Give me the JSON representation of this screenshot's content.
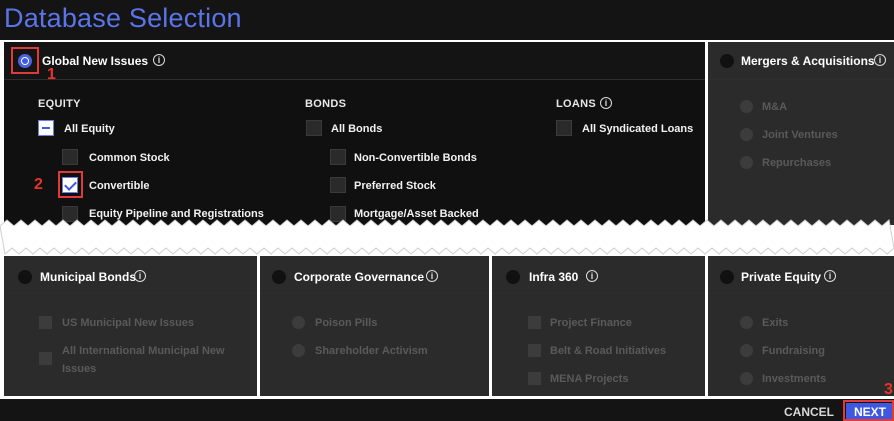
{
  "window": {
    "title": "Database Selection"
  },
  "global_new_issues": {
    "label": "Global New Issues",
    "info": "i",
    "columns": {
      "equity": {
        "heading": "EQUITY",
        "items": [
          "All Equity",
          "Common Stock",
          "Convertible",
          "Equity Pipeline and Registrations"
        ]
      },
      "bonds": {
        "heading": "BONDS",
        "items": [
          "All Bonds",
          "Non-Convertible Bonds",
          "Preferred Stock",
          "Mortgage/Asset Backed"
        ]
      },
      "loans": {
        "heading": "LOANS",
        "items": [
          "All Syndicated Loans"
        ]
      }
    }
  },
  "mergers": {
    "label": "Mergers & Acquisitions",
    "items": [
      "M&A",
      "Joint Ventures",
      "Repurchases"
    ]
  },
  "municipal": {
    "label": "Municipal Bonds",
    "items": [
      "US Municipal New Issues",
      "All International Municipal New",
      "Issues"
    ]
  },
  "governance": {
    "label": "Corporate Governance",
    "items": [
      "Poison Pills",
      "Shareholder Activism"
    ]
  },
  "infra": {
    "label": "Infra 360",
    "items": [
      "Project Finance",
      "Belt & Road Initiatives",
      "MENA Projects"
    ]
  },
  "private_equity": {
    "label": "Private Equity",
    "items": [
      "Exits",
      "Fundraising",
      "Investments"
    ]
  },
  "annotations": {
    "one": "1",
    "two": "2",
    "three": "3"
  },
  "footer": {
    "cancel": "CANCEL",
    "next": "NEXT"
  },
  "colors": {
    "accent": "#3e59e0",
    "title": "#5b74e8",
    "marker": "#e8332d",
    "panel_dark": "#101010",
    "panel_disabled": "#2b2b2b"
  }
}
